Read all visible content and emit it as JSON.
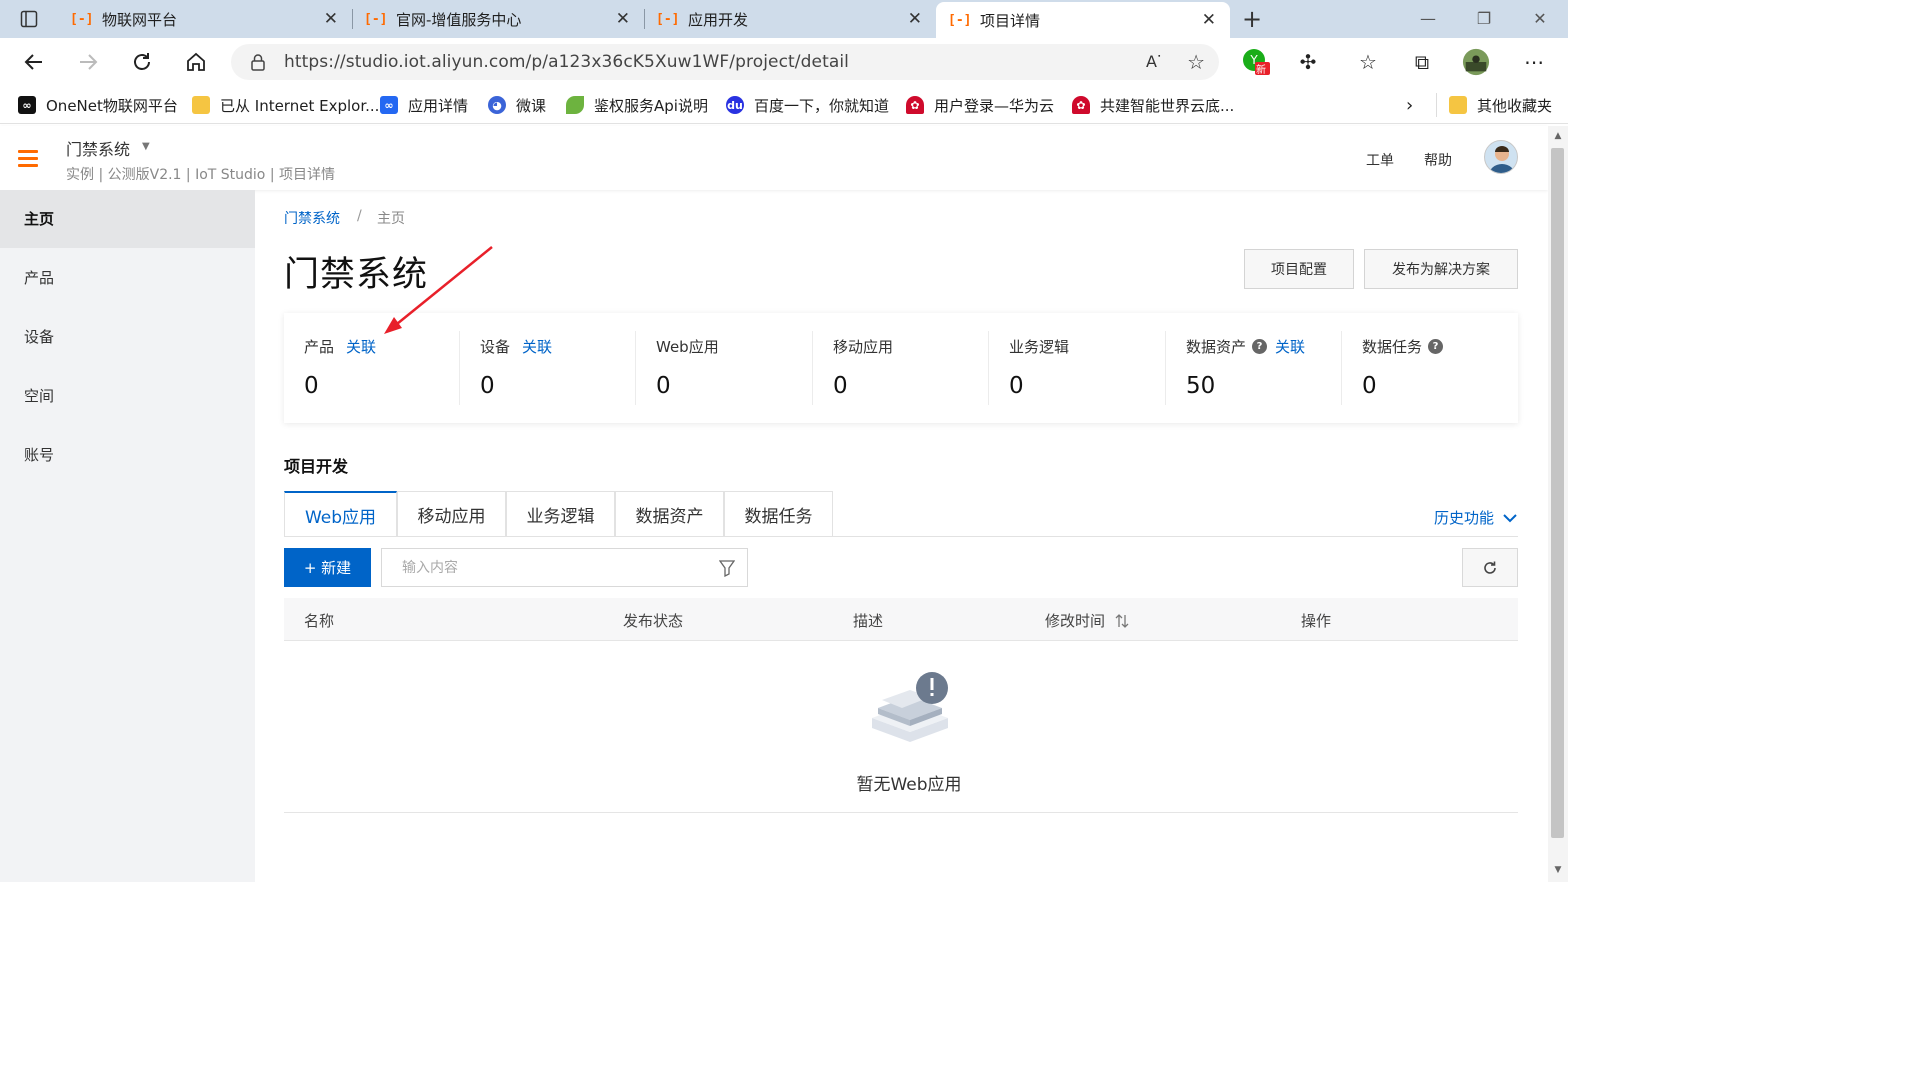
{
  "browser": {
    "tabs": [
      {
        "title": "物联网平台"
      },
      {
        "title": "官网-增值服务中心"
      },
      {
        "title": "应用开发"
      },
      {
        "title": "项目详情"
      }
    ],
    "url": "https://studio.iot.aliyun.com/p/a123x36cK5Xuw1WF/project/detail",
    "read_aloud": "A",
    "profile_badge": "新",
    "bookmarks": [
      {
        "label": "OneNet物联网平台"
      },
      {
        "label": "已从 Internet Explor..."
      },
      {
        "label": "应用详情"
      },
      {
        "label": "微课"
      },
      {
        "label": "鉴权服务Api说明"
      },
      {
        "label": "百度一下，你就知道"
      },
      {
        "label": "用户登录—华为云"
      },
      {
        "label": "共建智能世界云底..."
      }
    ],
    "other_bookmarks": "其他收藏夹"
  },
  "header": {
    "project_name": "门禁系统",
    "subtitle": "实例 | 公测版V2.1 | IoT Studio | 项目详情",
    "ticket": "工单",
    "help": "帮助"
  },
  "sidebar": {
    "items": [
      {
        "label": "主页"
      },
      {
        "label": "产品"
      },
      {
        "label": "设备"
      },
      {
        "label": "空间"
      },
      {
        "label": "账号"
      }
    ]
  },
  "breadcrumb": {
    "root": "门禁系统",
    "sep": "/",
    "current": "主页"
  },
  "page": {
    "title": "门禁系统",
    "config_button": "项目配置",
    "publish_button": "发布为解决方案"
  },
  "stats": [
    {
      "label": "产品",
      "link": "关联",
      "value": "0"
    },
    {
      "label": "设备",
      "link": "关联",
      "value": "0"
    },
    {
      "label": "Web应用",
      "value": "0"
    },
    {
      "label": "移动应用",
      "value": "0"
    },
    {
      "label": "业务逻辑",
      "value": "0"
    },
    {
      "label": "数据资产",
      "help": "?",
      "link": "关联",
      "value": "50"
    },
    {
      "label": "数据任务",
      "help": "?",
      "value": "0"
    }
  ],
  "dev": {
    "section_title": "项目开发",
    "tabs": [
      {
        "label": "Web应用"
      },
      {
        "label": "移动应用"
      },
      {
        "label": "业务逻辑"
      },
      {
        "label": "数据资产"
      },
      {
        "label": "数据任务"
      }
    ],
    "history": "历史功能",
    "new_button": "+ 新建",
    "search_placeholder": "输入内容",
    "columns": [
      "名称",
      "发布状态",
      "描述",
      "修改时间",
      "操作"
    ],
    "empty_text": "暂无Web应用"
  },
  "colors": {
    "brand": "#ff6a00",
    "link": "#0064c8",
    "annotation": "#e8202a"
  }
}
